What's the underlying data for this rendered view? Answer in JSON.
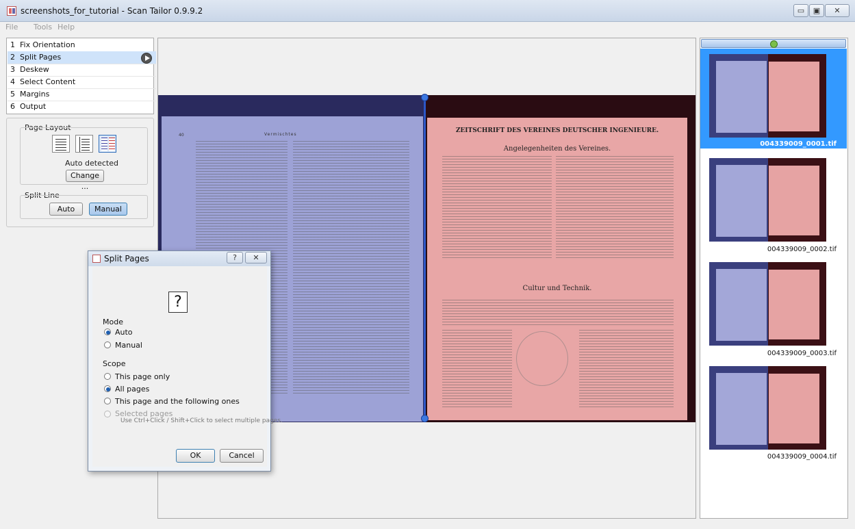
{
  "window": {
    "title": "screenshots_for_tutorial - Scan Tailor 0.9.9.2",
    "controls": [
      "▭",
      "▣",
      "✕"
    ]
  },
  "menubar": [
    "File",
    "Tools",
    "Help"
  ],
  "stages": [
    {
      "num": "1",
      "label": "Fix Orientation"
    },
    {
      "num": "2",
      "label": "Split Pages"
    },
    {
      "num": "3",
      "label": "Deskew"
    },
    {
      "num": "4",
      "label": "Select Content"
    },
    {
      "num": "5",
      "label": "Margins"
    },
    {
      "num": "6",
      "label": "Output"
    }
  ],
  "options": {
    "page_layout_label": "Page Layout",
    "layout_status": "Auto detected",
    "change_button": "Change ...",
    "split_line_label": "Split Line",
    "auto_button": "Auto",
    "manual_button": "Manual"
  },
  "thumbnails": [
    {
      "name": "004339009_0001.tif",
      "selected": true
    },
    {
      "name": "004339009_0002.tif",
      "selected": false
    },
    {
      "name": "004339009_0003.tif",
      "selected": false
    },
    {
      "name": "004339009_0004.tif",
      "selected": false
    }
  ],
  "dialog": {
    "title": "Split Pages",
    "help_button": "?",
    "close_button": "✕",
    "preview_glyph": "?",
    "mode_label": "Mode",
    "mode_auto": "Auto",
    "mode_manual": "Manual",
    "scope_label": "Scope",
    "scope_this_page": "This page only",
    "scope_all_pages": "All pages",
    "scope_following": "This page and the following ones",
    "scope_selected": "Selected pages",
    "scope_hint": "Use Ctrl+Click / Shift+Click to select multiple pages.",
    "ok_button": "OK",
    "cancel_button": "Cancel",
    "selected_mode": "Auto",
    "selected_scope": "All pages"
  },
  "document": {
    "left_header": "Vermischtes",
    "right_header": "ZEITSCHRIFT DES VEREINES DEUTSCHER INGENIEURE.",
    "right_heading1": "Angelegenheiten des Vereines.",
    "right_heading2": "Cultur und Technik."
  },
  "colors": {
    "accent": "#3399ff",
    "selected_stage": "#cfe3fa",
    "left_page_tint": "#9da2d6",
    "right_page_tint": "#e8a6a6",
    "split_line": "#2c57c7"
  }
}
